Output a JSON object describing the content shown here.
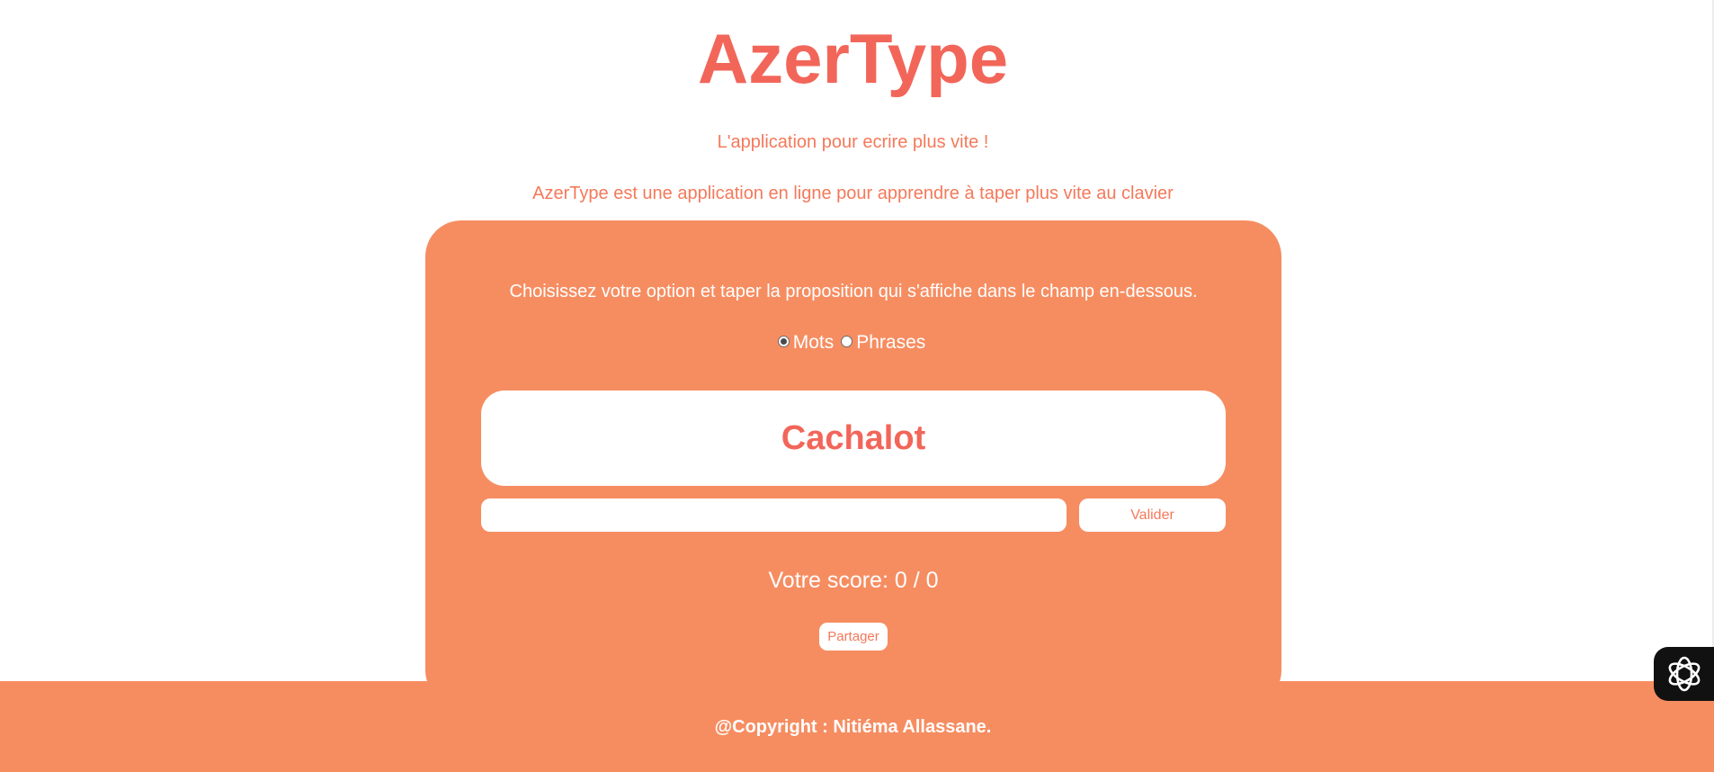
{
  "header": {
    "title": "AzerType",
    "tagline": "L'application pour ecrire plus vite !",
    "description": "AzerType est une application en ligne pour apprendre à taper plus vite au clavier"
  },
  "game": {
    "instructions": "Choisissez votre option et taper la proposition qui s'affiche dans le champ en-dessous.",
    "options": [
      {
        "label": "Mots",
        "checked": true
      },
      {
        "label": "Phrases",
        "checked": false
      }
    ],
    "proposal": "Cachalot",
    "input_value": "",
    "validate_label": "Valider",
    "score_text": "Votre score: 0 / 0",
    "share_label": "Partager"
  },
  "footer": {
    "copyright": "@Copyright : Nitiéma Allassane."
  },
  "colors": {
    "accent": "#f68d61",
    "title": "#f2665a",
    "text_light": "#f4795a",
    "white": "#ffffff"
  },
  "icons": {
    "assistant_badge": "assistant-logo-icon"
  }
}
